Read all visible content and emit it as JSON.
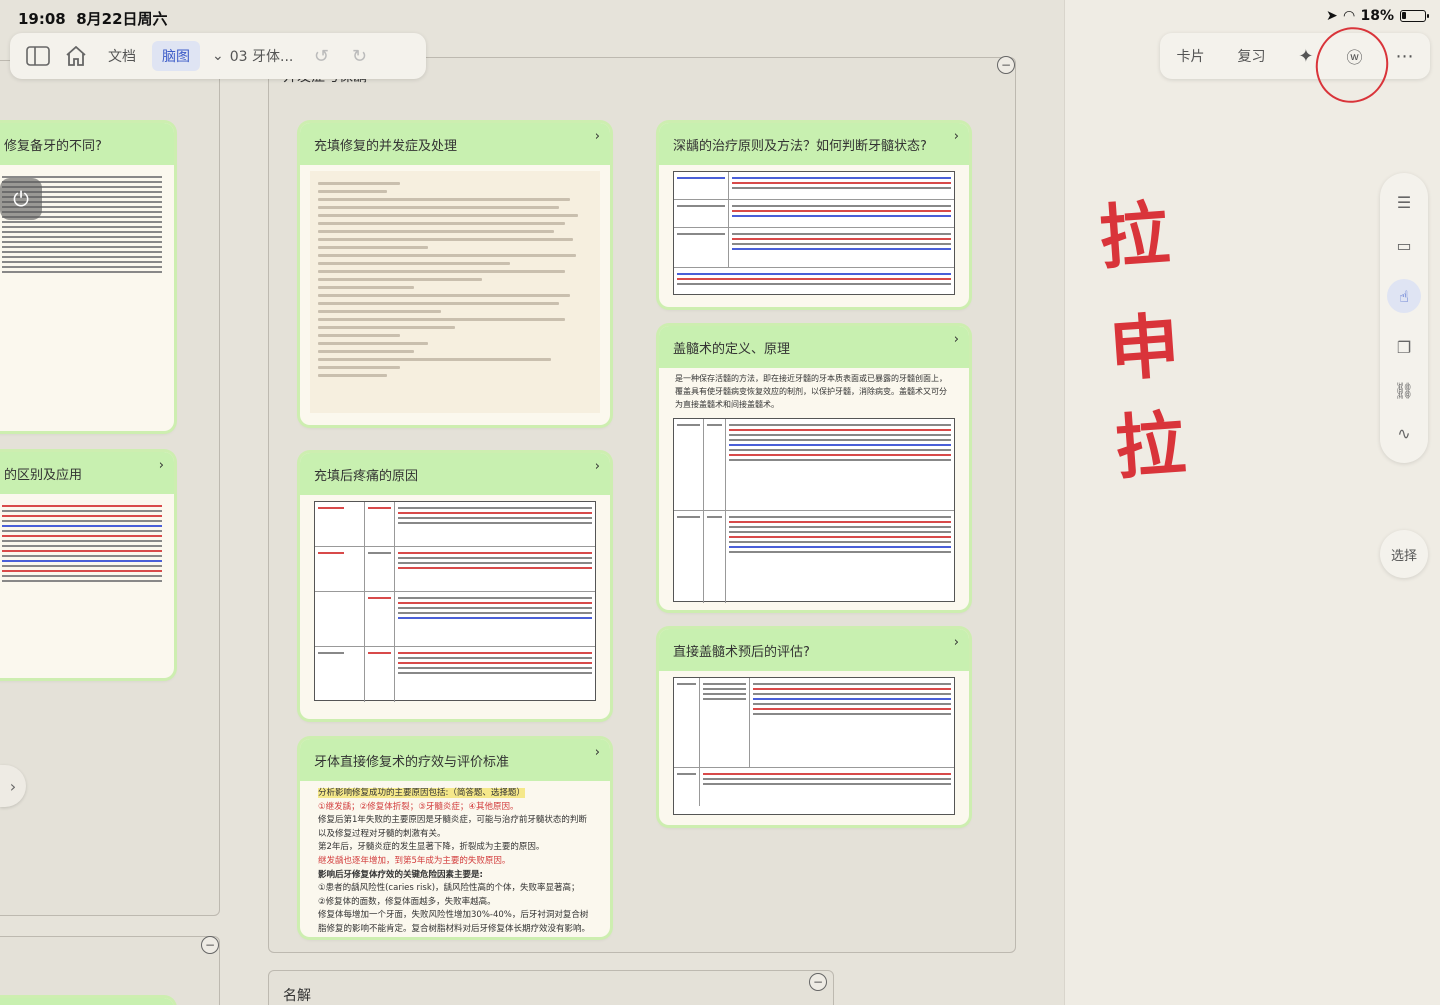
{
  "status": {
    "time": "19:08",
    "date": "8月22日周六",
    "battery": "18%"
  },
  "toolbar": {
    "doc_label": "文档",
    "mindmap_label": "脑图",
    "doc_name": "03 牙体...",
    "right": {
      "card_label": "卡片",
      "review_label": "复习"
    }
  },
  "side": {
    "select_label": "选择"
  },
  "frames": {
    "middle_title": "并发症与保龋",
    "bottom_title": "名解"
  },
  "cards": {
    "left_top_title": "修复备牙的不同?",
    "left_mid_title": "的区别及应用",
    "c1_title": "充填修复的并发症及处理",
    "c2_title": "充填后疼痛的原因",
    "c3_title": "牙体直接修复术的疗效与评价标准",
    "c4_title": "深龋的治疗原则及方法？如何判断牙髓状态?",
    "c5_title": "盖髓术的定义、原理",
    "c6_title": "直接盖髓术预后的评估?"
  },
  "c3_body": {
    "l1": "分析影响修复成功的主要原因包括:（简答题、选择题）",
    "l2": "①继发龋；②修复体折裂；③牙髓炎症；④其他原因。",
    "l3": "修复后第1年失败的主要原因是牙髓炎症，可能与治疗前牙髓状态的判断以及修复过程对牙髓的刺激有关。",
    "l4": "第2年后，牙髓炎症的发生显著下降，折裂成为主要的原因。",
    "l5": "继发龋也逐年增加，到第5年成为主要的失败原因。",
    "l6": "影响后牙修复体疗效的关键危险因素主要是:",
    "l7": "①患者的龋风险性(caries risk)，龋风险性高的个体，失败率显著高；",
    "l8": "②修复体的面数，修复体面越多，失败率越高。",
    "l9": "修复体每增加一个牙面，失败风险性增加30%-40%，后牙衬洞对复合树脂修复的影响不能肯定。复合树脂材料对后牙修复体长期疗效没有影响。"
  },
  "c5_body": {
    "intro": "是一种保存活髓的方法，即在接近牙髓的牙本质表面或已暴露的牙髓创面上，覆盖具有使牙髓病变恢复效应的制剂，以保护牙髓，消除病变。盖髓术又可分为直接盖髓术和间接盖髓术。"
  },
  "handwriting": {
    "a": "拉",
    "b": "申",
    "c": "拉"
  },
  "colors": {
    "card_header": "#c8f0b0",
    "accent": "#3d5cc8",
    "ink_red": "#d9343a"
  }
}
